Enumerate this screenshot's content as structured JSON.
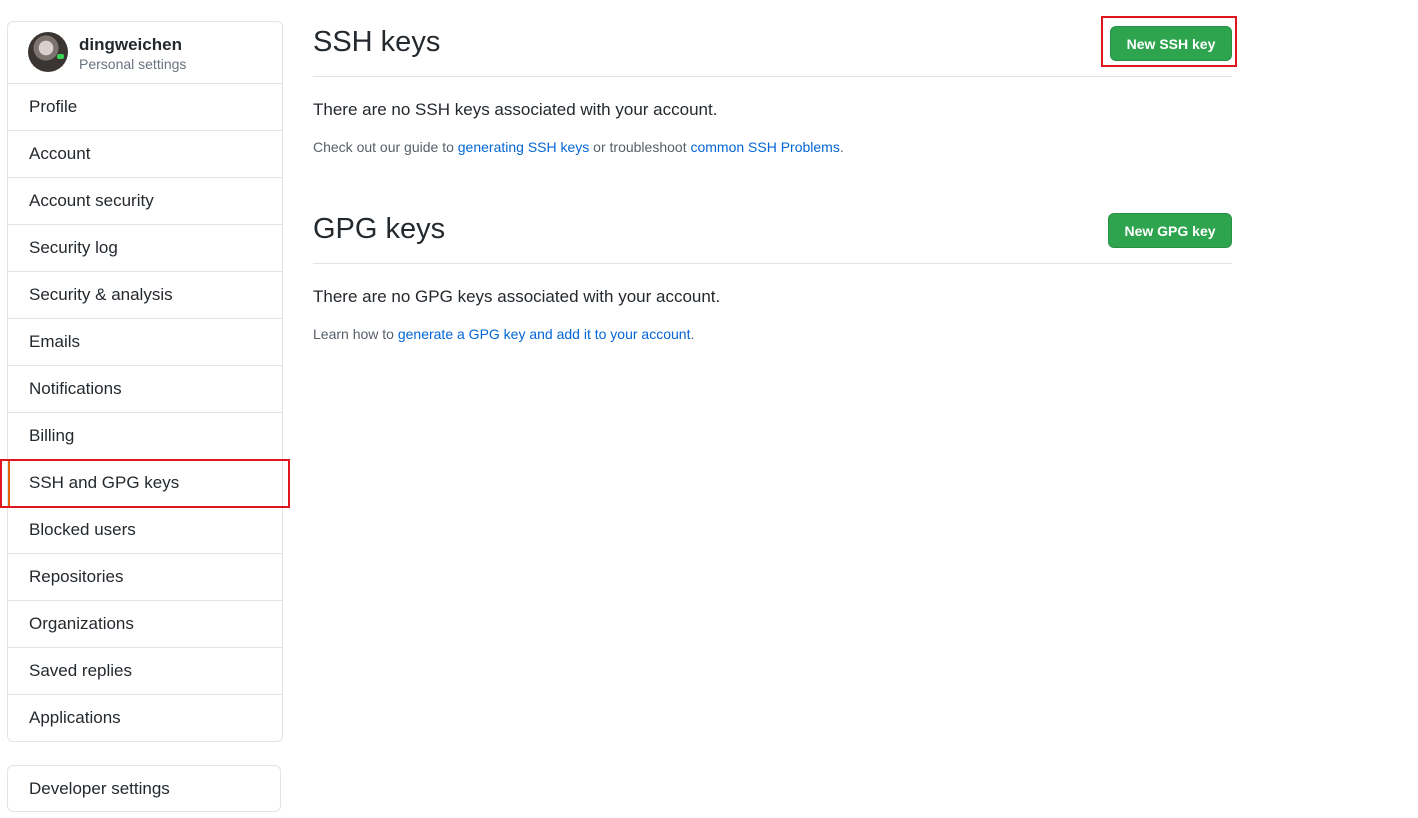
{
  "user": {
    "name": "dingweichen",
    "subtitle": "Personal settings"
  },
  "sidebar": {
    "items": [
      {
        "label": "Profile"
      },
      {
        "label": "Account"
      },
      {
        "label": "Account security"
      },
      {
        "label": "Security log"
      },
      {
        "label": "Security & analysis"
      },
      {
        "label": "Emails"
      },
      {
        "label": "Notifications"
      },
      {
        "label": "Billing"
      },
      {
        "label": "SSH and GPG keys",
        "selected": true
      },
      {
        "label": "Blocked users"
      },
      {
        "label": "Repositories"
      },
      {
        "label": "Organizations"
      },
      {
        "label": "Saved replies"
      },
      {
        "label": "Applications"
      }
    ],
    "developer_settings": "Developer settings"
  },
  "ssh": {
    "title": "SSH keys",
    "button": "New SSH key",
    "empty_message": "There are no SSH keys associated with your account.",
    "note_prefix": "Check out our guide to ",
    "link1": "generating SSH keys",
    "note_middle": " or troubleshoot ",
    "link2": "common SSH Problems",
    "note_suffix": "."
  },
  "gpg": {
    "title": "GPG keys",
    "button": "New GPG key",
    "empty_message": "There are no GPG keys associated with your account.",
    "note_prefix": "Learn how to ",
    "link1": "generate a GPG key and add it to your account",
    "note_suffix": "."
  },
  "colors": {
    "button_green": "#2ea44f",
    "link_blue": "#0366d6",
    "annotation_red": "#e0161e"
  }
}
